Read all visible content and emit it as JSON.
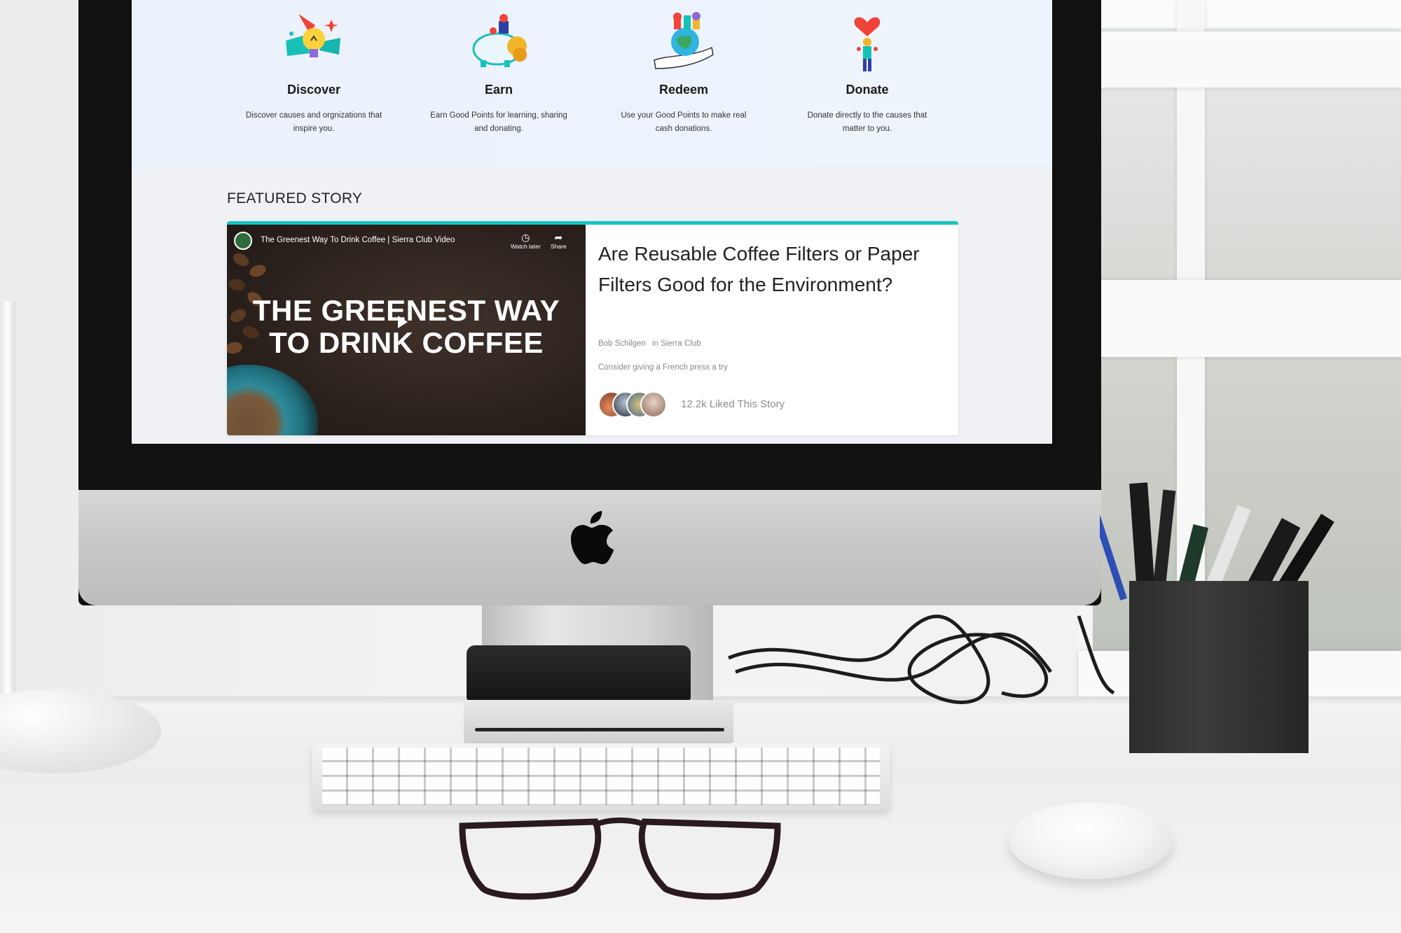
{
  "steps": [
    {
      "title": "Discover",
      "desc": "Discover causes and orgnizations that inspire you.",
      "icon": "lightbulb-icon"
    },
    {
      "title": "Earn",
      "desc": "Earn Good Points for learning, sharing and donating.",
      "icon": "piggy-bank-icon"
    },
    {
      "title": "Redeem",
      "desc": "Use your Good Points to make real cash donations.",
      "icon": "hand-globe-icon"
    },
    {
      "title": "Donate",
      "desc": "Donate directly to the causes that matter to you.",
      "icon": "heart-person-icon"
    }
  ],
  "featured": {
    "heading": "FEATURED STORY",
    "video": {
      "title": "The Greenest Way To Drink Coffee | Sierra Club Video",
      "watch_later": "Watch later",
      "share": "Share",
      "headline_line1": "THE GREENEST WAY",
      "headline_line2": "TO DRINK COFFEE"
    },
    "story": {
      "title": "Are Reusable Coffee Filters or Paper Filters Good for the Environment?",
      "author": "Bob Schilgen",
      "in_label": "in Sierra Club",
      "subtitle": "Consider giving a French press a try",
      "likes": "12.2k Liked This Story"
    }
  },
  "colors": {
    "accent": "#16c3c2",
    "screen_background": "#eef3fb"
  }
}
